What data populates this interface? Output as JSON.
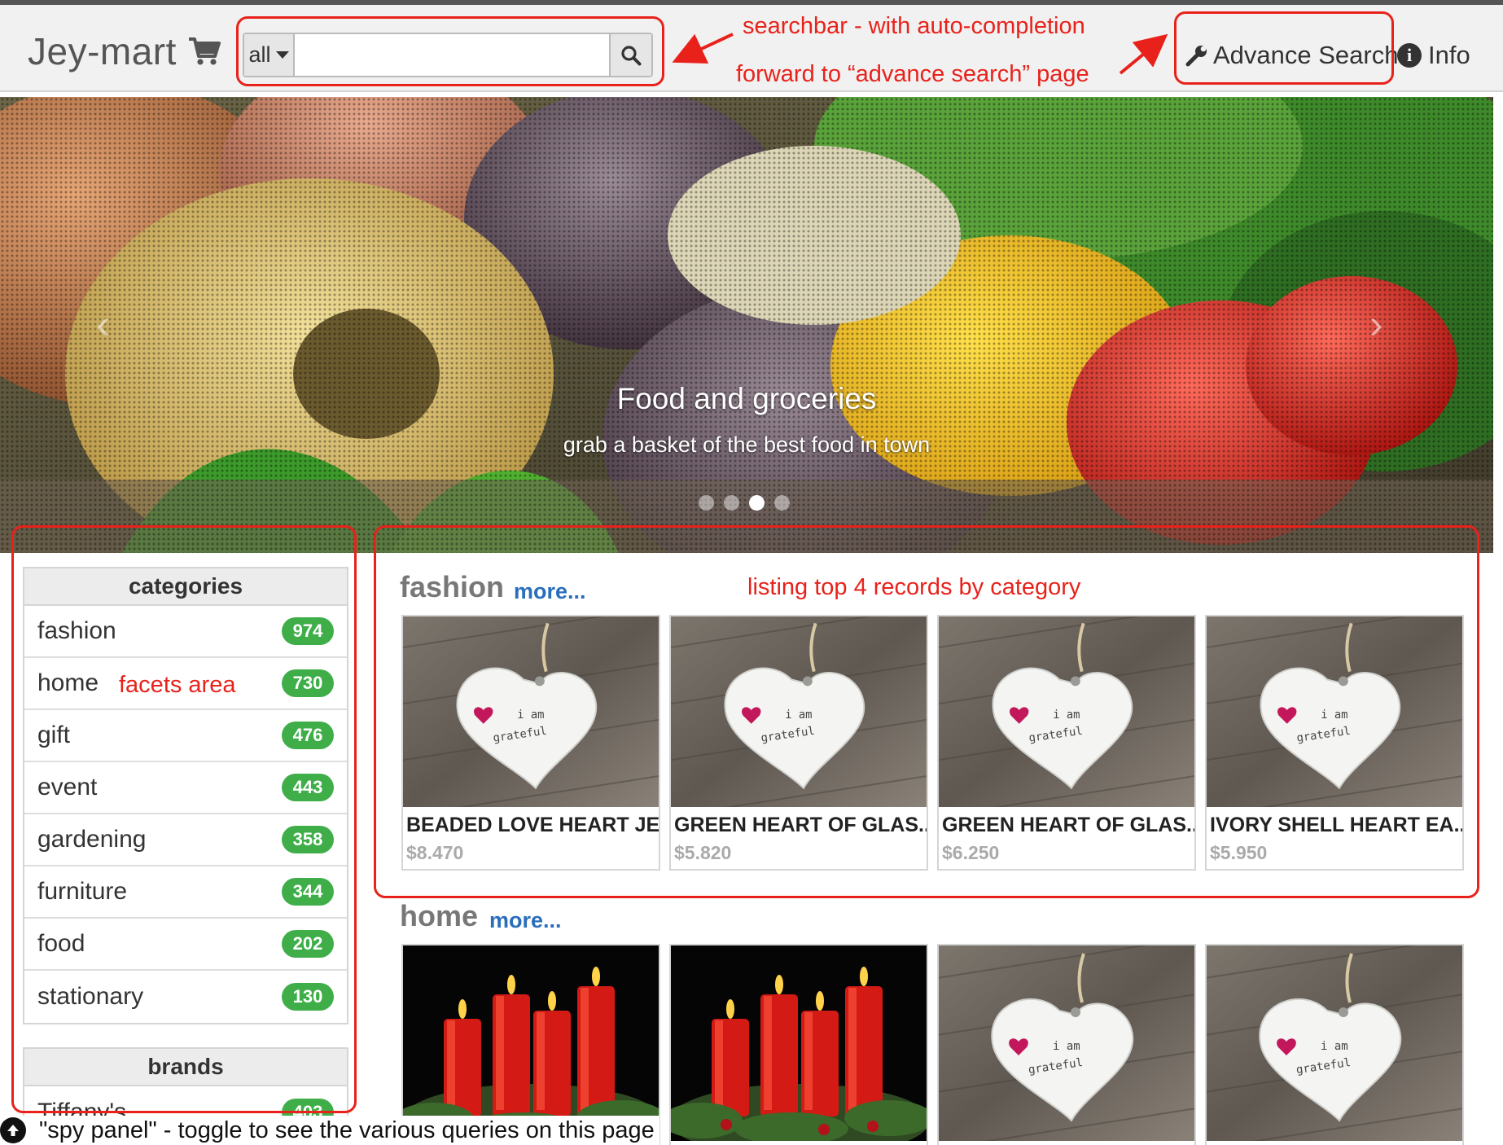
{
  "header": {
    "brand": "Jey-mart",
    "search": {
      "scope": "all",
      "value": "",
      "placeholder": ""
    },
    "nav": {
      "advance_search": "Advance Search",
      "info": "Info"
    }
  },
  "hero": {
    "title": "Food and groceries",
    "subtitle": "grab a basket of the best food in town",
    "slide_count": 4,
    "active_slide": 3
  },
  "facets": {
    "categories": {
      "heading": "categories",
      "items": [
        {
          "label": "fashion",
          "count": "974"
        },
        {
          "label": "home",
          "count": "730"
        },
        {
          "label": "gift",
          "count": "476"
        },
        {
          "label": "event",
          "count": "443"
        },
        {
          "label": "gardening",
          "count": "358"
        },
        {
          "label": "furniture",
          "count": "344"
        },
        {
          "label": "food",
          "count": "202"
        },
        {
          "label": "stationary",
          "count": "130"
        }
      ]
    },
    "brands": {
      "heading": "brands",
      "items": [
        {
          "label": "Tiffany's",
          "count": "403"
        }
      ]
    }
  },
  "sections": [
    {
      "title": "fashion",
      "more": "more...",
      "products": [
        {
          "name": "BEADED LOVE HEART JE...",
          "price": "$8.470",
          "image": "heart-ornament"
        },
        {
          "name": "GREEN HEART OF GLAS...",
          "price": "$5.820",
          "image": "heart-ornament"
        },
        {
          "name": "GREEN HEART OF GLAS...",
          "price": "$6.250",
          "image": "heart-ornament"
        },
        {
          "name": "IVORY SHELL HEART EA...",
          "price": "$5.950",
          "image": "heart-ornament"
        }
      ]
    },
    {
      "title": "home",
      "more": "more...",
      "products": [
        {
          "image": "advent-candles"
        },
        {
          "image": "advent-candles"
        },
        {
          "image": "heart-ornament"
        },
        {
          "image": "heart-ornament"
        }
      ]
    }
  ],
  "heart_text": {
    "line1": "i am",
    "line2": "grateful"
  },
  "annotations": {
    "searchbar": "searchbar - with auto-completion",
    "advance": "forward to “advance search” page",
    "facets": "facets area",
    "listing": "listing top 4 records by category",
    "spy": "\"spy panel\" - toggle to see the various queries on this page"
  },
  "colors": {
    "annotation": "#e8221b",
    "badge": "#3fae49",
    "link": "#2a6ebb"
  }
}
